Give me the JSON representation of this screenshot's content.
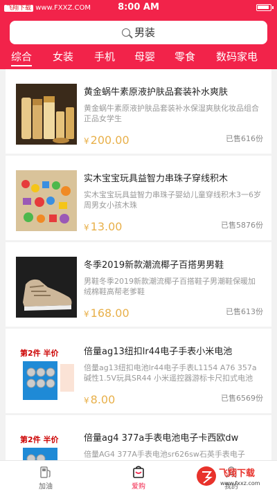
{
  "statusbar": {
    "watermark": "飞翔下载",
    "watermark_url": "www.FXXZ.COM",
    "time": "8:00 AM"
  },
  "search": {
    "placeholder": "男装"
  },
  "tabs": [
    {
      "label": "综合",
      "active": true
    },
    {
      "label": "女装"
    },
    {
      "label": "手机"
    },
    {
      "label": "母婴"
    },
    {
      "label": "零食"
    },
    {
      "label": "数码家电"
    }
  ],
  "products": [
    {
      "title": "黄金蜗牛素原液护肤品套装补水爽肤",
      "desc": "黄金蜗牛素原液护肤品套装补水保湿爽肤化妆品组合正品女学生",
      "currency": "¥",
      "price": "200.00",
      "sold": "已售616份",
      "image": "cosmetics-set"
    },
    {
      "title": "实木宝宝玩具益智力串珠子穿线积木",
      "desc": "实木宝宝玩具益智力串珠子婴幼儿童穿线积木3一6岁周男女小孩木珠",
      "currency": "¥",
      "price": "13.00",
      "sold": "已售5876份",
      "image": "wooden-beads"
    },
    {
      "title": "冬季2019新款潮流椰子百搭男男鞋",
      "desc": "男鞋冬季2019新款潮流椰子百搭鞋子男潮鞋保暖加绒棉鞋高帮老爹鞋",
      "currency": "¥",
      "price": "168.00",
      "sold": "已售613份",
      "image": "sneaker"
    },
    {
      "title": "倍量ag13纽扣lr44电子手表小米电池",
      "desc": "倍量ag13纽扣电池lr44电子手表L1154 A76 357a碱性1.5V玩具SR44 小米遥控器游标卡尺扣式电池",
      "currency": "¥",
      "price": "8.00",
      "sold": "已售6569份",
      "image": "button-battery",
      "promo": "第2件 半价"
    },
    {
      "title": "倍量ag4 377a手表电池电子卡西欧dw",
      "desc": "倍量AG4 377A手表电池sr626sw石英手表电子",
      "currency": "¥",
      "price": "",
      "sold": "",
      "image": "button-battery-2",
      "promo": "第2件 半价"
    }
  ],
  "tabbar": [
    {
      "label": "加油",
      "icon": "fuel-pump-icon"
    },
    {
      "label": "爱购",
      "icon": "shopping-bag-icon",
      "active": true
    },
    {
      "label": "我的",
      "icon": "user-icon"
    }
  ],
  "overlay_watermark": {
    "text": "飞翔下载",
    "url": "www.fxxz.com"
  },
  "colors": {
    "brand": "#f2234a",
    "price": "#e8b04a"
  }
}
